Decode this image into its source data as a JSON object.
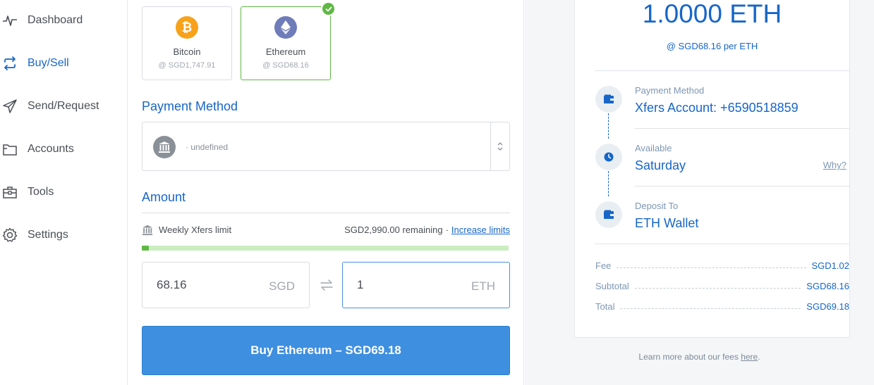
{
  "sidebar": {
    "items": [
      {
        "label": "Dashboard",
        "icon": "activity-icon"
      },
      {
        "label": "Buy/Sell",
        "icon": "exchange-icon"
      },
      {
        "label": "Send/Request",
        "icon": "send-icon"
      },
      {
        "label": "Accounts",
        "icon": "folder-icon"
      },
      {
        "label": "Tools",
        "icon": "toolbox-icon"
      },
      {
        "label": "Settings",
        "icon": "gear-icon"
      }
    ],
    "active_index": 1
  },
  "coins": [
    {
      "name": "Bitcoin",
      "price": "@ SGD1,747.91",
      "color": "#f7a21b",
      "selected": false
    },
    {
      "name": "Ethereum",
      "price": "@ SGD68.16",
      "color": "#6f7cba",
      "selected": true
    }
  ],
  "payment": {
    "title": "Payment Method",
    "selected_text": "· undefined"
  },
  "amount": {
    "title": "Amount",
    "limit_label": "Weekly Xfers limit",
    "remaining": "SGD2,990.00 remaining",
    "separator": "·",
    "increase_link": "Increase limits",
    "limit_used_fraction": 0.02,
    "fiat_value": "68.16",
    "fiat_currency": "SGD",
    "crypto_value": "1",
    "crypto_currency": "ETH"
  },
  "buy_button": "Buy Ethereum – SGD69.18",
  "summary": {
    "amount": "1.0000 ETH",
    "rate": "@ SGD68.16 per ETH",
    "steps": [
      {
        "label": "Payment Method",
        "value": "Xfers Account: +6590518859",
        "icon": "wallet-icon"
      },
      {
        "label": "Available",
        "value": "Saturday",
        "icon": "clock-icon",
        "link": "Why?"
      },
      {
        "label": "Deposit To",
        "value": "ETH Wallet",
        "icon": "wallet-icon"
      }
    ],
    "fees": [
      {
        "label": "Fee",
        "value": "SGD1.02"
      },
      {
        "label": "Subtotal",
        "value": "SGD68.16"
      },
      {
        "label": "Total",
        "value": "SGD69.18"
      }
    ],
    "learn_prefix": "Learn more about our fees ",
    "learn_link": "here",
    "learn_suffix": "."
  },
  "colors": {
    "accent": "#1766c8",
    "button": "#3e8fe0",
    "success": "#5fb844"
  }
}
